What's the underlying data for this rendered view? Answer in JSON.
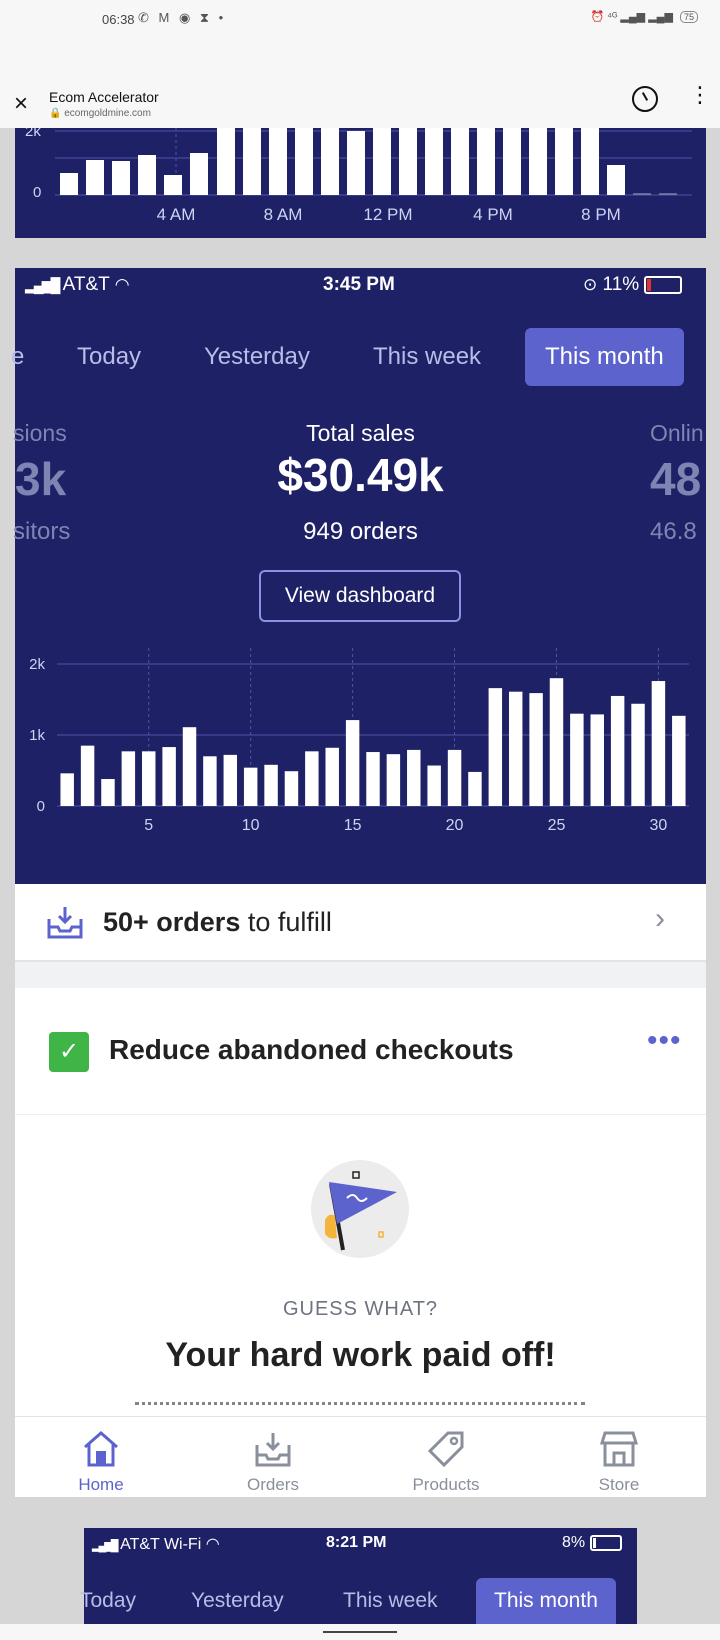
{
  "system_bar": {
    "time": "06:38",
    "notification_icons": "✆ M ◉ ⧗ •",
    "right_icons": "⏰ ⁴ᴳ ▂▄▆ ▂▄▆",
    "battery": "75"
  },
  "browser": {
    "title": "Ecom Accelerator",
    "url": "ecomgoldmine.com",
    "close_icon": "×",
    "menu_icon": "⋮"
  },
  "top_chart": {
    "y_tick_top": "2k",
    "y_tick_zero": "0",
    "x_ticks": [
      "4 AM",
      "8 AM",
      "12 PM",
      "4 PM",
      "8 PM"
    ]
  },
  "phone_status": {
    "carrier": "AT&T",
    "time": "3:45 PM",
    "battery": "11%"
  },
  "tabs": [
    {
      "label": "e"
    },
    {
      "label": "Today"
    },
    {
      "label": "Yesterday"
    },
    {
      "label": "This week"
    },
    {
      "label": "This month",
      "active": true
    }
  ],
  "metrics": {
    "left": {
      "label": "sions",
      "value": "3k",
      "sub": "sitors"
    },
    "center": {
      "label": "Total sales",
      "value": "$30.49k",
      "sub": "949 orders"
    },
    "right": {
      "label": "Onlin",
      "value": "48",
      "sub": "46.8"
    }
  },
  "view_dashboard": "View dashboard",
  "chart_data": {
    "type": "bar",
    "x": [
      1,
      2,
      3,
      4,
      5,
      6,
      7,
      8,
      9,
      10,
      11,
      12,
      13,
      14,
      15,
      16,
      17,
      18,
      19,
      20,
      21,
      22,
      23,
      24,
      25,
      26,
      27,
      28,
      29,
      30,
      31
    ],
    "values": [
      460,
      850,
      380,
      770,
      770,
      830,
      1110,
      700,
      720,
      540,
      580,
      490,
      770,
      820,
      1210,
      760,
      730,
      790,
      570,
      790,
      480,
      1660,
      1610,
      1590,
      1800,
      1300,
      1290,
      1550,
      1440,
      1760,
      1270
    ],
    "ylim": [
      0,
      2000
    ],
    "yticks": [
      "0",
      "1k",
      "2k"
    ],
    "xticks": [
      "5",
      "10",
      "15",
      "20",
      "25",
      "30"
    ],
    "grid": true,
    "colors": {
      "bar": "#ffffff",
      "background": "#1f2166",
      "grid": "#4f54a8"
    }
  },
  "fulfill": {
    "bold": "50+ orders",
    "rest": " to fulfill"
  },
  "task_card": {
    "title": "Reduce abandoned checkouts",
    "more": "•••",
    "eyebrow": "GUESS WHAT?",
    "headline": "Your hard work paid off!"
  },
  "nav": [
    {
      "label": "Home",
      "icon": "home-icon",
      "active": true
    },
    {
      "label": "Orders",
      "icon": "orders-icon"
    },
    {
      "label": "Products",
      "icon": "tag-icon"
    },
    {
      "label": "Store",
      "icon": "store-icon"
    }
  ],
  "screen3": {
    "carrier": "AT&T Wi-Fi",
    "time": "8:21 PM",
    "battery": "8%",
    "tabs": [
      {
        "label": "Today"
      },
      {
        "label": "Yesterday"
      },
      {
        "label": "This week"
      },
      {
        "label": "This month",
        "active": true
      }
    ]
  },
  "colors": {
    "accent": "#5c63cc",
    "panel": "#1f2166",
    "success": "#3fb447"
  }
}
